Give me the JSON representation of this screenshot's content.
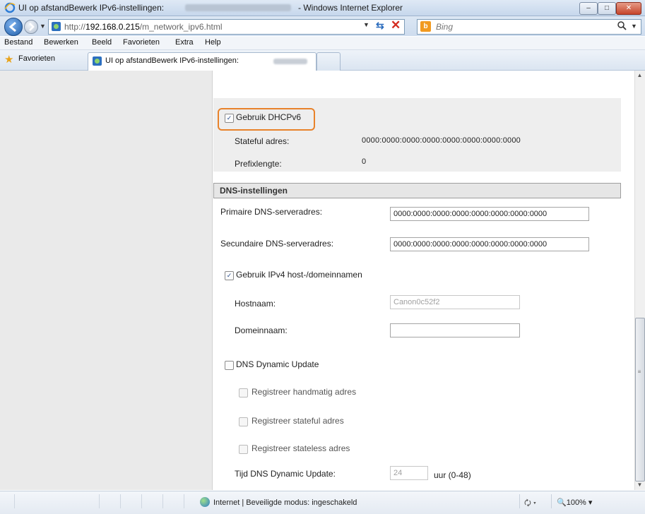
{
  "window": {
    "title": "UI op afstandBewerk IPv6-instellingen:",
    "app_name": "- Windows Internet Explorer",
    "controls": {
      "minimize": "–",
      "maximize": "□",
      "close": "✕"
    }
  },
  "address_bar": {
    "url_prefix": "http://",
    "url_host": "192.168.0.215",
    "url_path": "/m_network_ipv6.html",
    "search_placeholder": "Bing",
    "search_logo": "b"
  },
  "menu": [
    "Bestand",
    "Bewerken",
    "Beeld",
    "Favorieten",
    "Extra",
    "Help"
  ],
  "favorites": {
    "label": "Favorieten",
    "tab_title": "UI op afstandBewerk IPv6-instellingen:"
  },
  "dhcp": {
    "use_dhcpv6_label": "Gebruik DHCPv6",
    "use_dhcpv6_checked": true,
    "stateful_label": "Stateful adres:",
    "stateful_value": "0000:0000:0000:0000:0000:0000:0000:0000",
    "prefix_label": "Prefixlengte:",
    "prefix_value": "0"
  },
  "dns": {
    "section_title": "DNS-instellingen",
    "primary_label": "Primaire DNS-serveradres:",
    "primary_value": "0000:0000:0000:0000:0000:0000:0000:0000",
    "secondary_label": "Secundaire DNS-serveradres:",
    "secondary_value": "0000:0000:0000:0000:0000:0000:0000:0000",
    "use_ipv4_label": "Gebruik IPv4 host-/domeinnamen",
    "use_ipv4_checked": true,
    "hostname_label": "Hostnaam:",
    "hostname_value": "Canon0c52f2",
    "domain_label": "Domeinnaam:",
    "domain_value": "",
    "dynamic_update_label": "DNS Dynamic Update",
    "dynamic_update_checked": false,
    "register_manual_label": "Registreer handmatig adres",
    "register_stateful_label": "Registreer stateful adres",
    "register_stateless_label": "Registreer stateless adres",
    "update_time_label": "Tijd DNS Dynamic Update:",
    "update_time_value": "24",
    "update_time_unit": "uur (0-48)"
  },
  "status": {
    "zone_text": "Internet | Beveiligde modus: ingeschakeld",
    "zoom": "100%"
  },
  "colors": {
    "highlight_ring": "#e8822a",
    "titlebar": "#c6d7ec",
    "close_button": "#c6462c"
  }
}
